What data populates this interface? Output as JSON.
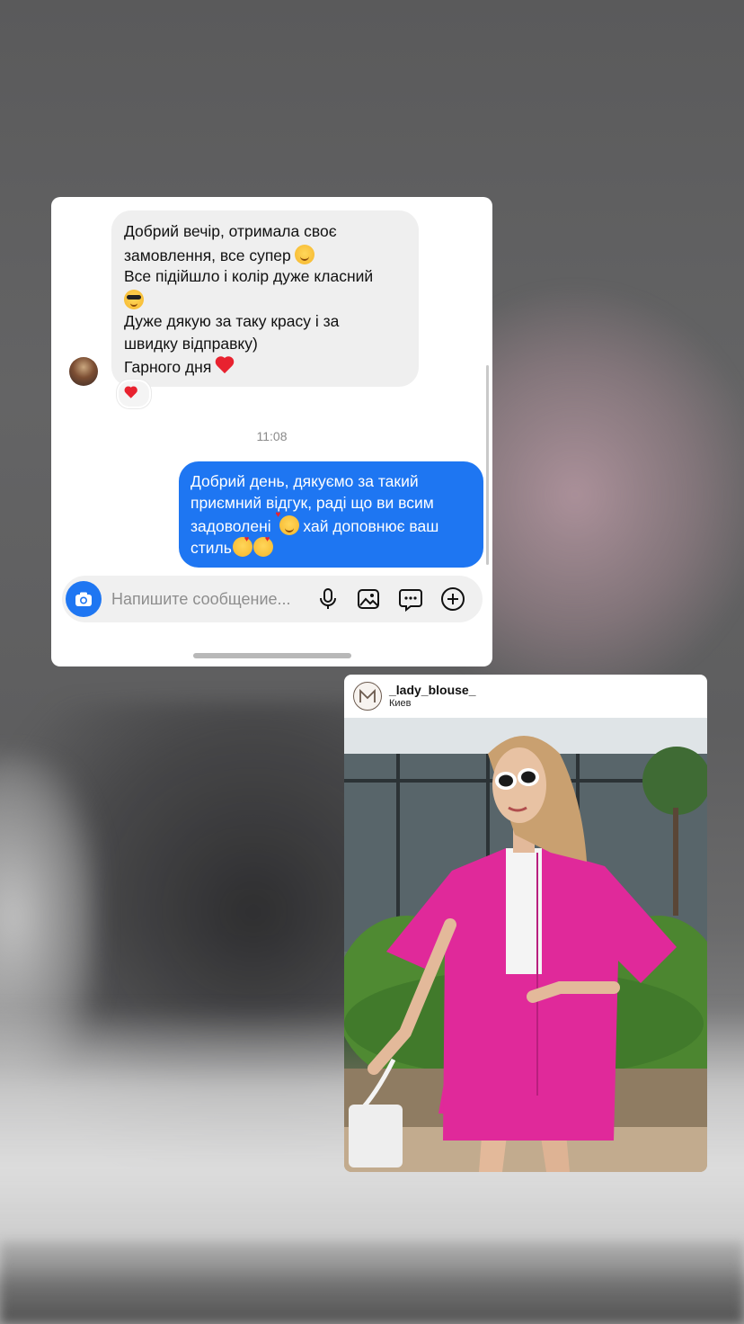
{
  "chat": {
    "incoming_lines": [
      "Добрий вечір, отримала своє",
      "замовлення, все супер",
      "Все підійшло і колір дуже класний",
      "",
      "Дуже дякую за таку красу і за",
      "швидку відправку)",
      "Гарного дня"
    ],
    "time": "11:08",
    "outgoing_lines": [
      "Добрий день, дякуємо за такий",
      "приємний відгук, раді що ви всим",
      "задоволені",
      "хай доповнює ваш",
      "стиль"
    ],
    "composer_placeholder": "Напишите сообщение...",
    "icons": {
      "camera": "camera-icon",
      "mic": "microphone-icon",
      "gallery": "image-icon",
      "sticker": "chat-bubble-icon",
      "add": "plus-circle-icon"
    },
    "colors": {
      "accent": "#1e76f2",
      "incoming_bg": "#efefef",
      "heart": "#e8222f"
    }
  },
  "post": {
    "username": "_lady_blouse_",
    "location": "Киев",
    "colors": {
      "outfit": "#e0299a"
    }
  }
}
